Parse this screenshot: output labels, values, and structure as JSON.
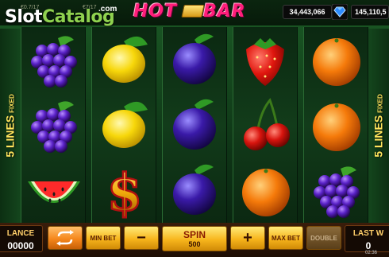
{
  "top": {
    "logo_slot": "Slot",
    "logo_catalog": "Catalog",
    "logo_com": ".com",
    "tiny_left": "€0.7/17",
    "tiny_right": "€7/17",
    "title_hot": "HOT",
    "title_bar": "BAR",
    "credits": "34,443,066",
    "balance_right": "145,110,5",
    "gem_icon": "diamond-icon"
  },
  "sides": {
    "left_label": "5 LINES",
    "left_sub": "FIXED",
    "right_label": "5 LINES",
    "right_sub": "FIXED"
  },
  "reels": [
    [
      "grapes",
      "grapes",
      "watermelon"
    ],
    [
      "lemon",
      "lemon",
      "dollar"
    ],
    [
      "plum",
      "plum",
      "plum"
    ],
    [
      "strawberry",
      "cherry",
      "orange"
    ],
    [
      "orange",
      "orange",
      "grapes"
    ]
  ],
  "bottom": {
    "balance_label": "LANCE",
    "balance_value": "00000",
    "min_bet": "MIN BET",
    "minus": "−",
    "spin_label": "SPIN",
    "spin_value": "500",
    "plus": "+",
    "max_bet": "MAX BET",
    "double": "DOUBLE",
    "last_win_label": "LAST W",
    "last_win_value": "0",
    "clock": "02:36"
  },
  "colors": {
    "accent_gold": "#f7b51c",
    "reel_bg": "#123c1a",
    "title_pink": "#ff1e7a"
  }
}
